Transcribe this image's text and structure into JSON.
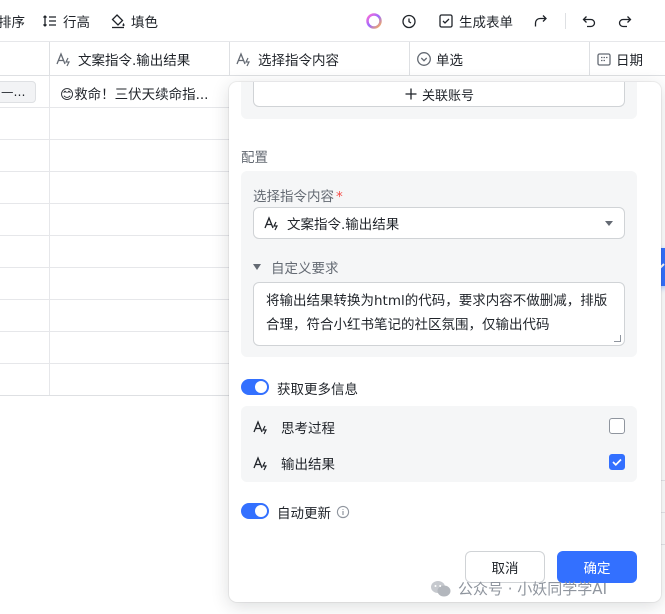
{
  "toolbar": {
    "sort_label": "排序",
    "row_height_label": "行高",
    "fill_label": "填色",
    "generate_form_label": "生成表单",
    "icons": [
      "row-height-icon",
      "fill-color-icon",
      "ai-orb-icon",
      "history-icon",
      "form-icon",
      "share-icon",
      "undo-icon",
      "redo-icon"
    ]
  },
  "grid": {
    "columns": [
      {
        "label": "文案指令.输出结果",
        "icon": "ai-text-icon"
      },
      {
        "label": "选择指令内容",
        "icon": "ai-text-icon"
      },
      {
        "label": "单选",
        "icon": "single-select-icon"
      },
      {
        "label": "日期",
        "icon": "calendar-icon"
      }
    ],
    "first_row": {
      "chip": "—...",
      "text": "😊救命！三伏天续命指..."
    }
  },
  "panel": {
    "associate_account_label": "关联账号",
    "config_title": "配置",
    "select_label": "选择指令内容",
    "required_mark": "*",
    "select_value": "文案指令.输出结果",
    "custom_requirements_label": "自定义要求",
    "custom_requirements_text": "将输出结果转换为html的代码，要求内容不做删减，排版合理，符合小红书笔记的社区氛围，仅输出代码",
    "more_info_label": "获取更多信息",
    "more_info_enabled": true,
    "more_items": [
      {
        "label": "思考过程",
        "checked": false
      },
      {
        "label": "输出结果",
        "checked": true
      }
    ],
    "auto_update_label": "自动更新",
    "auto_update_enabled": true,
    "cancel_label": "取消",
    "ok_label": "确定"
  },
  "watermark": {
    "text": "公众号 · 小妖同学学AI"
  },
  "colors": {
    "accent": "#3370ff",
    "required": "#f54a45",
    "panel_bg": "#f5f6f7"
  }
}
